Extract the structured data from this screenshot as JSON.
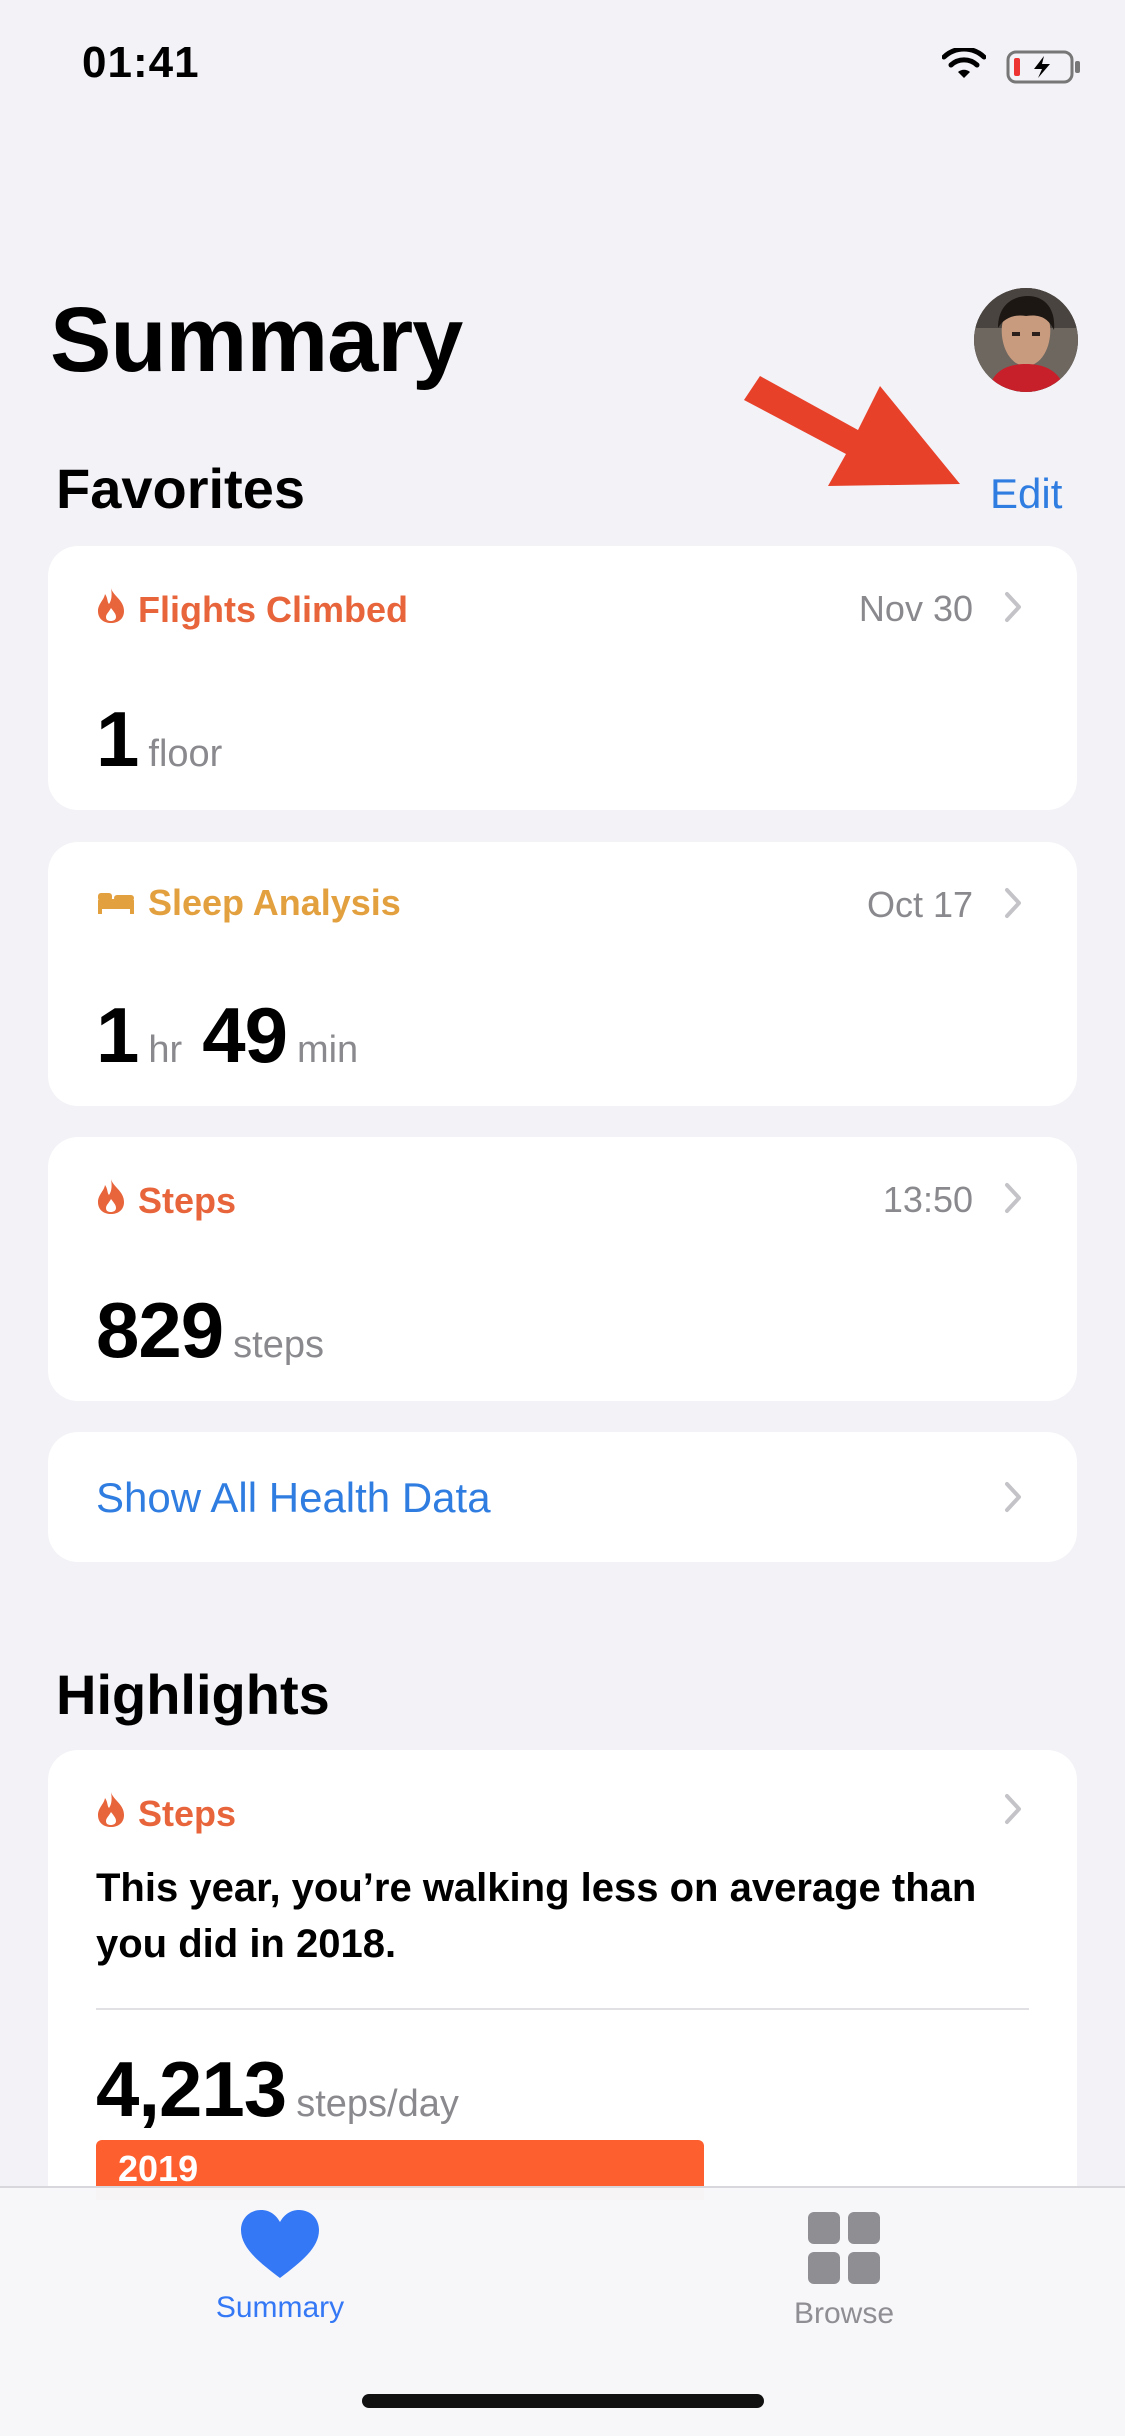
{
  "status_bar": {
    "time": "01:41"
  },
  "header": {
    "title": "Summary"
  },
  "favorites": {
    "title": "Favorites",
    "edit_label": "Edit",
    "cards": [
      {
        "label": "Flights Climbed",
        "date": "Nov 30",
        "value": "1",
        "unit": "floor",
        "icon": "flame-icon"
      },
      {
        "label": "Sleep Analysis",
        "date": "Oct 17",
        "value_hr": "1",
        "unit_hr": "hr",
        "value_min": "49",
        "unit_min": "min",
        "icon": "bed-icon"
      },
      {
        "label": "Steps",
        "date": "13:50",
        "value": "829",
        "unit": "steps",
        "icon": "flame-icon"
      }
    ],
    "show_all_label": "Show All Health Data"
  },
  "highlights": {
    "title": "Highlights",
    "card": {
      "label": "Steps",
      "text": "This year, you’re walking less on average than you did in 2018.",
      "value": "4,213",
      "unit": "steps/day",
      "bar_label": "2019"
    }
  },
  "tabbar": {
    "items": [
      {
        "label": "Summary",
        "active": true,
        "icon": "heart-icon"
      },
      {
        "label": "Browse",
        "active": false,
        "icon": "grid-icon"
      }
    ]
  },
  "colors": {
    "accent_blue": "#2f7de1",
    "activity_orange": "#e8643a",
    "sleep_amber": "#e3a03f",
    "annotation_arrow": "#e8412a"
  }
}
